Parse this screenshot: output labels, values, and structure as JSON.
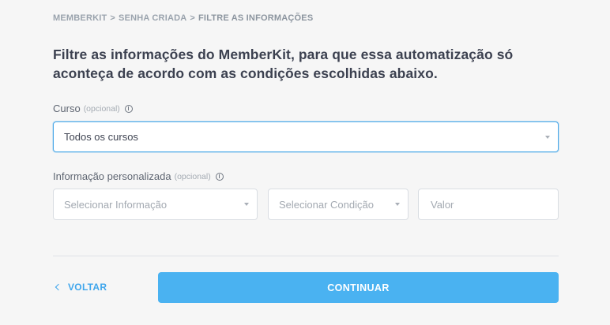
{
  "breadcrumb": {
    "items": [
      "MEMBERKIT",
      "SENHA CRIADA",
      "FILTRE AS INFORMAÇÕES"
    ],
    "separator": ">"
  },
  "headline": "Filtre as informações do MemberKit, para que essa automatização só aconteça de acordo com as condições escolhidas abaixo.",
  "course_filter": {
    "label": "Curso",
    "optional_label": "(opcional)",
    "selected_value": "Todos os cursos"
  },
  "custom_info_filter": {
    "label": "Informação personalizada",
    "optional_label": "(opcional)",
    "info_placeholder": "Selecionar Informação",
    "condition_placeholder": "Selecionar Condição",
    "value_placeholder": "Valor"
  },
  "footer": {
    "back_label": "VOLTAR",
    "continue_label": "CONTINUAR"
  },
  "colors": {
    "accent": "#4ab2f1",
    "link": "#3fa6ec",
    "focus_border": "#4aa8e8",
    "background": "#f6f6f6"
  }
}
